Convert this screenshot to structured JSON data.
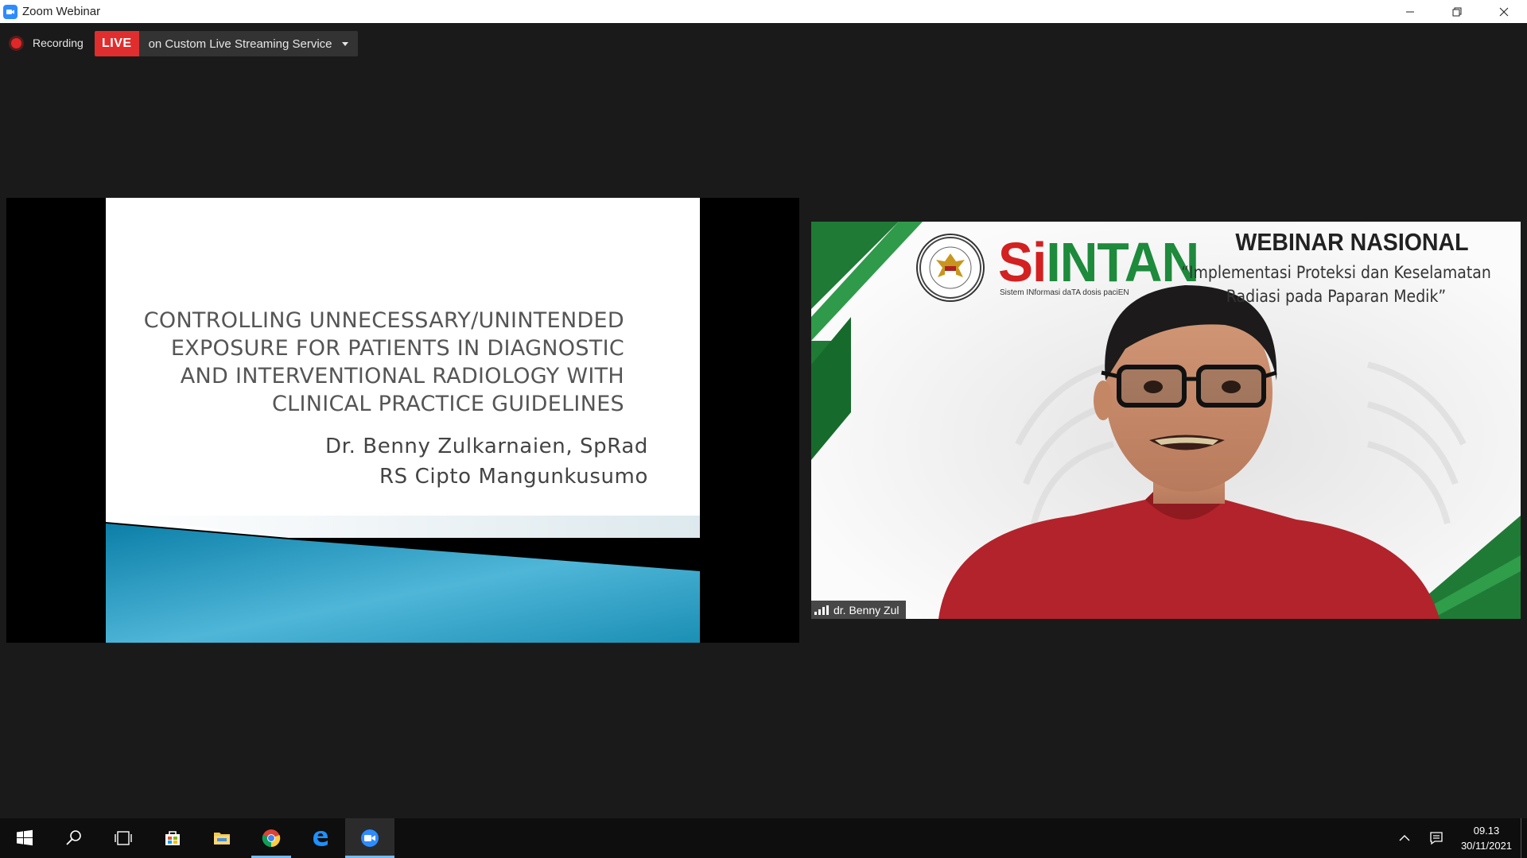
{
  "window": {
    "title": "Zoom Webinar",
    "icon": "zoom-camera-icon"
  },
  "recording": {
    "label": "Recording"
  },
  "live": {
    "badge": "LIVE",
    "service": "on Custom Live Streaming Service"
  },
  "slide": {
    "title": "CONTROLLING UNNECESSARY/UNINTENDED\nEXPOSURE FOR PATIENTS IN DIAGNOSTIC\nAND INTERVENTIONAL RADIOLOGY WITH\nCLINICAL PRACTICE GUIDELINES",
    "author": "Dr. Benny Zulkarnaien, SpRad",
    "institution": "RS Cipto Mangunkusumo"
  },
  "video": {
    "participant_name": "dr. Benny Zul",
    "banner": {
      "logo_text_s": "Si",
      "logo_text_rest": "INTAN",
      "logo_subtext": "Sistem INformasi daTA dosis paciEN",
      "title": "WEBINAR NASIONAL",
      "subtitle_line1": "“Implementasi Proteksi dan Keselamatan",
      "subtitle_line2": "Radiasi pada Paparan Medik”"
    }
  },
  "taskbar": {
    "apps": [
      "windows-start-icon",
      "search-icon",
      "task-view-icon",
      "store-icon",
      "file-explorer-icon",
      "chrome-icon",
      "edge-icon",
      "zoom-icon"
    ],
    "time": "09.13",
    "date": "30/11/2021"
  },
  "colors": {
    "live_red": "#e02e2e",
    "zoom_blue": "#2d8cff",
    "brand_green": "#1e8a3c",
    "shirt_red": "#b3232b"
  }
}
